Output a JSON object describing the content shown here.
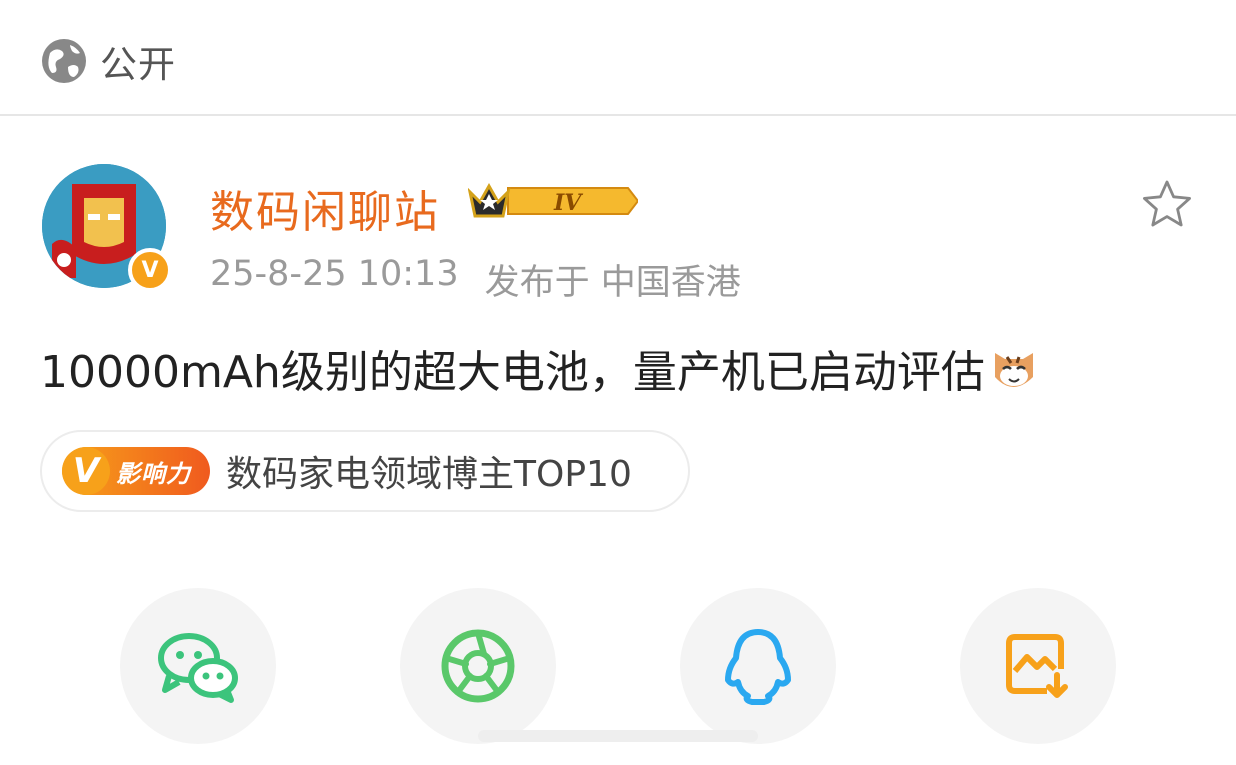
{
  "visibility": {
    "label": "公开",
    "icon": "globe-icon"
  },
  "post": {
    "author": "数码闲聊站",
    "level_badge": "IV",
    "verified_mark": "V",
    "timestamp": "25-8-25 10:13",
    "location": "发布于 中国香港",
    "text": "10000mAh级别的超大电池，量产机已启动评估",
    "emoji": "cat-face-emoji"
  },
  "influence": {
    "badge_letter": "V",
    "badge_label": "影响力",
    "text": "数码家电领域博主TOP10"
  },
  "share": [
    {
      "name": "wechat",
      "icon": "wechat-icon",
      "color": "#3cc47c"
    },
    {
      "name": "moments",
      "icon": "moments-icon",
      "color": "#5ac86a"
    },
    {
      "name": "qq",
      "icon": "qq-icon",
      "color": "#2aa8f0"
    },
    {
      "name": "save-image",
      "icon": "save-image-icon",
      "color": "#f7a11a"
    }
  ]
}
